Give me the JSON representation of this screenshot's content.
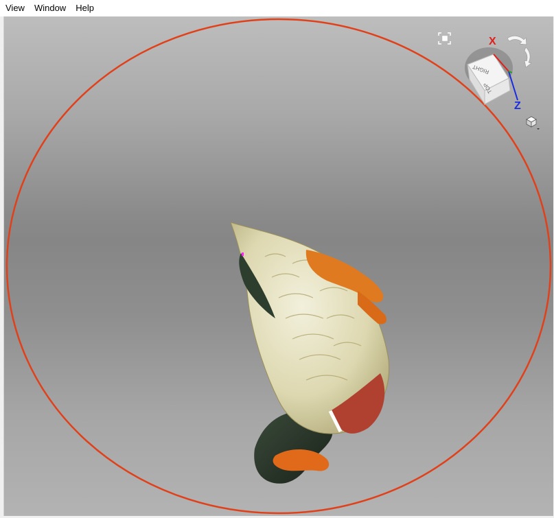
{
  "menubar": {
    "items": [
      "View",
      "Window",
      "Help"
    ]
  },
  "viewcube": {
    "faces": {
      "top": "TOP",
      "right": "RIGHT"
    },
    "axes": {
      "x": "X",
      "z": "Z"
    },
    "colors": {
      "x": "#e0201a",
      "z": "#1a2be0",
      "y": "#1aa51a"
    }
  },
  "colors": {
    "orbit_ring": "#e0401a"
  },
  "icons": {
    "zoom_extents": "zoom-extents-icon",
    "rotate": "rotate-arrows-icon",
    "home": "home-cube-icon"
  }
}
